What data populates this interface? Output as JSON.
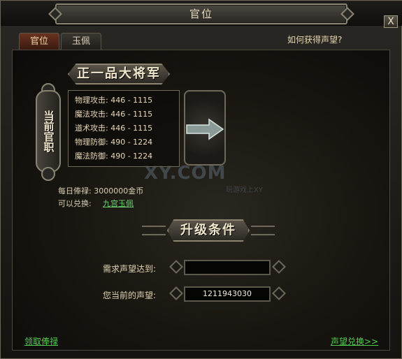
{
  "window": {
    "title": "官位",
    "close_symbol": "X"
  },
  "tabs": [
    {
      "label": "官位",
      "active": true
    },
    {
      "label": "玉佩",
      "active": false
    }
  ],
  "help_link": "如何获得声望?",
  "current_rank": {
    "title": "正一品大将军",
    "side_label": "当前官职",
    "stats": [
      {
        "name": "物理攻击:",
        "value": "446 - 1115"
      },
      {
        "name": "魔法攻击:",
        "value": "446 - 1115"
      },
      {
        "name": "道术攻击:",
        "value": "446 - 1115"
      },
      {
        "name": "物理防御:",
        "value": "490 - 1224"
      },
      {
        "name": "魔法防御:",
        "value": "490 - 1224"
      }
    ]
  },
  "daily_salary": "每日俸禄: 3000000金币",
  "exchange": {
    "label": "可以兑换:",
    "item": "九宫玉佩"
  },
  "upgrade": {
    "title": "升级条件",
    "required_label": "需求声望达到:",
    "required_value": "",
    "current_label": "您当前的声望:",
    "current_value": "1211943030"
  },
  "footer": {
    "claim_salary": "领取俸禄",
    "exchange_reputation": "声望兑换>>"
  },
  "watermark": {
    "main": "XY.COM",
    "sub": "玩游戏上XY"
  },
  "colors": {
    "link_green": "#4fcf4f",
    "gold_text": "#f0e6cc",
    "active_tab": "#6a3220"
  }
}
